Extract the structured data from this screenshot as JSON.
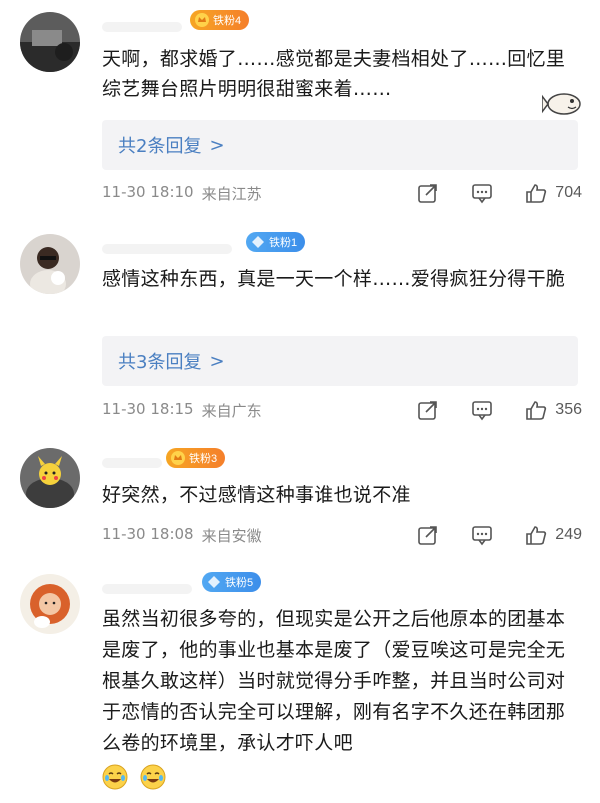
{
  "comments": [
    {
      "badge": "铁粉4",
      "text": "天啊，都求婚了……感觉都是夫妻档相处了……回忆里综艺舞台照片明明很甜蜜来着……",
      "replies": "共2条回复",
      "time": "11-30 18:10",
      "location": "来自江苏",
      "likes": "704"
    },
    {
      "badge": "铁粉1",
      "text": "感情这种东西，真是一天一个样……爱得疯狂分得干脆",
      "replies": "共3条回复",
      "time": "11-30 18:15",
      "location": "来自广东",
      "likes": "356"
    },
    {
      "badge": "铁粉3",
      "text": "好突然，不过感情这种事谁也说不准",
      "time": "11-30 18:08",
      "location": "来自安徽",
      "likes": "249"
    },
    {
      "badge": "铁粉5",
      "text": "虽然当初很多夸的，但现实是公开之后他原本的团基本是废了，他的事业也基本是废了（爱豆唉这可是完全无根基久敢这样）当时就觉得分手咋整，并且当时公司对于恋情的否认完全可以理解，刚有名字不久还在韩团那么卷的环境里，承认才吓人吧"
    }
  ],
  "reply_arrow": ">",
  "icons": {
    "share": "share-icon",
    "comment": "comment-icon",
    "like": "thumbs-up-icon"
  },
  "colors": {
    "link": "#4a7fc1",
    "meta": "#8a8a8a",
    "badge_orange": "#f6a623",
    "badge_blue": "#52a8f2"
  }
}
